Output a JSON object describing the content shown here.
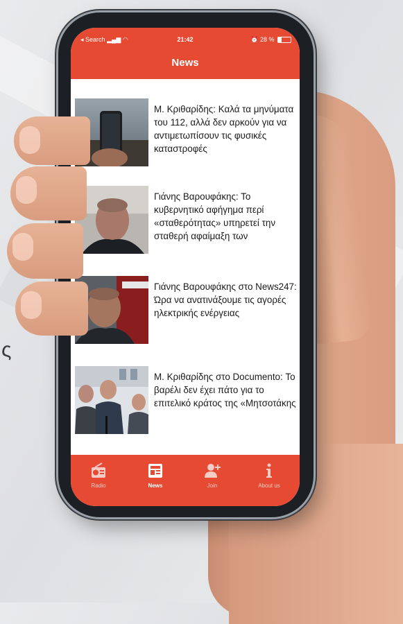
{
  "status_bar": {
    "carrier": "◂ Search",
    "time": "21:42",
    "battery": "28 %",
    "battery_level": 0.28
  },
  "header": {
    "title": "News"
  },
  "articles": [
    {
      "headline": "Μ. Κριθαρίδης: Καλά τα μηνύματα του 112, αλλά δεν αρκούν για να αντιμετωπίσουν τις φυσικές καταστροφές",
      "image": "phone-in-hand-photo"
    },
    {
      "headline": "Γιάνης Βαρουφάκης: Το κυβερνητικό αφήγημα περί «σταθερότητας» υπηρετεί την σταθερή αφαίμαξη των",
      "image": "portrait-photo"
    },
    {
      "headline": "Γιάνης Βαρουφάκης στο News247: Ώρα να ανατινάξουμε τις αγορές ηλεκτρικής ενέργειας",
      "image": "portrait-photo"
    },
    {
      "headline": "Μ. Κριθαρίδης στο Documento: Το βαρέλι δεν έχει πάτο για το επιτελικό κράτος της «Μητσοτάκης",
      "image": "press-conference-photo"
    }
  ],
  "tabs": [
    {
      "label": "Radio",
      "icon": "radio-icon",
      "active": false
    },
    {
      "label": "News",
      "icon": "news-icon",
      "active": true
    },
    {
      "label": "Join",
      "icon": "add-user-icon",
      "active": false
    },
    {
      "label": "About us",
      "icon": "info-icon",
      "active": false
    }
  ],
  "colors": {
    "accent": "#e64a33",
    "background": "#ffffff",
    "text": "#1a1a1a"
  }
}
